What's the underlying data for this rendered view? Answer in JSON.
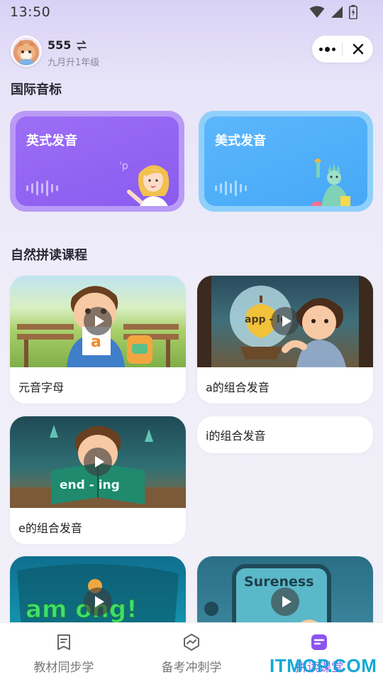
{
  "status_bar": {
    "time": "13:50"
  },
  "header": {
    "user_name": "555",
    "grade": "九月升1年级"
  },
  "sections": {
    "phonetics_title": "国际音标",
    "phonics_title": "自然拼读课程"
  },
  "phonetic_cards": [
    {
      "label": "英式发音",
      "color": "#9d6ef5"
    },
    {
      "label": "美式发音",
      "color": "#5cb7fb"
    }
  ],
  "courses": [
    {
      "title": "元音字母",
      "thumb_text": "a"
    },
    {
      "title": "a的组合发音",
      "thumb_text": "app - le"
    },
    {
      "title": "i的组合发音"
    },
    {
      "title": "e的组合发音",
      "thumb_text": "end - ing"
    },
    {
      "thumb_text": "am ong!"
    },
    {
      "thumb_text": "Sureness"
    }
  ],
  "tabs": [
    {
      "label": "教材同步学",
      "icon": "book-icon"
    },
    {
      "label": "备考冲刺学",
      "icon": "trend-icon"
    },
    {
      "label": "拼读课堂",
      "icon": "note-icon",
      "active": true
    }
  ],
  "watermark": "ITMOP.COM",
  "colors": {
    "accent": "#8c55f0"
  }
}
